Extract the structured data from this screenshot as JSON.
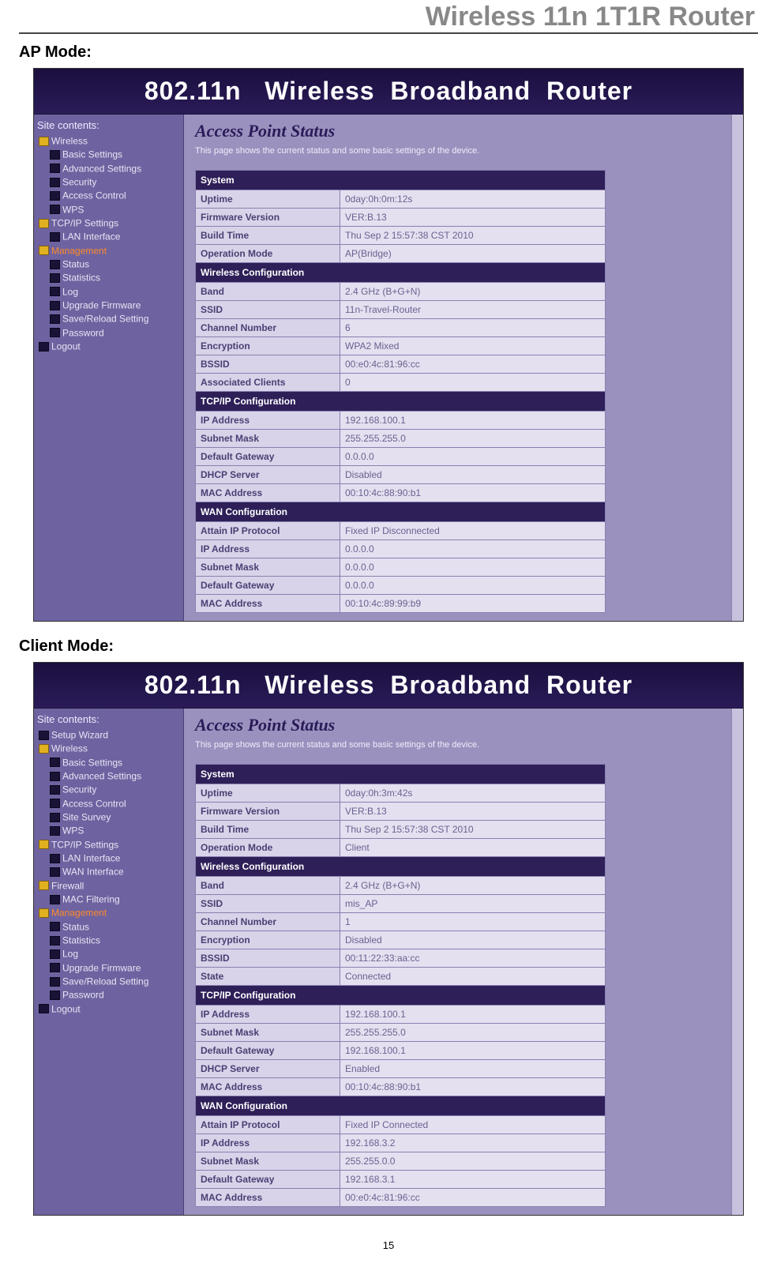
{
  "doc": {
    "header": "Wireless 11n 1T1R Router",
    "page_number": "15",
    "ap_mode_label": "AP Mode:",
    "client_mode_label": "Client Mode:"
  },
  "common": {
    "banner": "802.11n   Wireless  Broadband  Router",
    "sidebar_title": "Site contents:",
    "page_title": "Access Point Status",
    "page_desc": "This page shows the current status and some basic settings of the device."
  },
  "ap": {
    "sidebar": [
      {
        "type": "folder",
        "label": "Wireless",
        "children": [
          {
            "type": "page",
            "label": "Basic Settings"
          },
          {
            "type": "page",
            "label": "Advanced Settings"
          },
          {
            "type": "page",
            "label": "Security"
          },
          {
            "type": "page",
            "label": "Access Control"
          },
          {
            "type": "page",
            "label": "WPS"
          }
        ]
      },
      {
        "type": "folder",
        "label": "TCP/IP Settings",
        "children": [
          {
            "type": "page",
            "label": "LAN Interface"
          }
        ]
      },
      {
        "type": "folder",
        "label": "Management",
        "active": true,
        "children": [
          {
            "type": "page",
            "label": "Status"
          },
          {
            "type": "page",
            "label": "Statistics"
          },
          {
            "type": "page",
            "label": "Log"
          },
          {
            "type": "page",
            "label": "Upgrade Firmware"
          },
          {
            "type": "page",
            "label": "Save/Reload Setting"
          },
          {
            "type": "page",
            "label": "Password"
          }
        ]
      },
      {
        "type": "page",
        "label": "Logout"
      }
    ],
    "sections": [
      {
        "heading": "System",
        "rows": [
          {
            "label": "Uptime",
            "value": "0day:0h:0m:12s"
          },
          {
            "label": "Firmware Version",
            "value": "VER:B.13"
          },
          {
            "label": "Build Time",
            "value": "Thu Sep 2 15:57:38 CST 2010"
          },
          {
            "label": "Operation Mode",
            "value": "AP(Bridge)"
          }
        ]
      },
      {
        "heading": "Wireless Configuration",
        "rows": [
          {
            "label": "Band",
            "value": "2.4 GHz (B+G+N)"
          },
          {
            "label": "SSID",
            "value": "11n-Travel-Router"
          },
          {
            "label": "Channel Number",
            "value": "6"
          },
          {
            "label": "Encryption",
            "value": "WPA2 Mixed"
          },
          {
            "label": "BSSID",
            "value": "00:e0:4c:81:96:cc"
          },
          {
            "label": "Associated Clients",
            "value": "0"
          }
        ]
      },
      {
        "heading": "TCP/IP Configuration",
        "rows": [
          {
            "label": "IP Address",
            "value": "192.168.100.1"
          },
          {
            "label": "Subnet Mask",
            "value": "255.255.255.0"
          },
          {
            "label": "Default Gateway",
            "value": "0.0.0.0"
          },
          {
            "label": "DHCP Server",
            "value": "Disabled"
          },
          {
            "label": "MAC Address",
            "value": "00:10:4c:88:90:b1"
          }
        ]
      },
      {
        "heading": "WAN Configuration",
        "rows": [
          {
            "label": "Attain IP Protocol",
            "value": "Fixed IP Disconnected"
          },
          {
            "label": "IP Address",
            "value": "0.0.0.0"
          },
          {
            "label": "Subnet Mask",
            "value": "0.0.0.0"
          },
          {
            "label": "Default Gateway",
            "value": "0.0.0.0"
          },
          {
            "label": "MAC Address",
            "value": "00:10:4c:89:99:b9"
          }
        ]
      }
    ]
  },
  "client": {
    "sidebar": [
      {
        "type": "page",
        "label": "Setup Wizard"
      },
      {
        "type": "folder",
        "label": "Wireless",
        "children": [
          {
            "type": "page",
            "label": "Basic Settings"
          },
          {
            "type": "page",
            "label": "Advanced Settings"
          },
          {
            "type": "page",
            "label": "Security"
          },
          {
            "type": "page",
            "label": "Access Control"
          },
          {
            "type": "page",
            "label": "Site Survey"
          },
          {
            "type": "page",
            "label": "WPS"
          }
        ]
      },
      {
        "type": "folder",
        "label": "TCP/IP Settings",
        "children": [
          {
            "type": "page",
            "label": "LAN Interface"
          },
          {
            "type": "page",
            "label": "WAN Interface"
          }
        ]
      },
      {
        "type": "folder",
        "label": "Firewall",
        "children": [
          {
            "type": "page",
            "label": "MAC Filtering"
          }
        ]
      },
      {
        "type": "folder",
        "label": "Management",
        "active": true,
        "children": [
          {
            "type": "page",
            "label": "Status"
          },
          {
            "type": "page",
            "label": "Statistics"
          },
          {
            "type": "page",
            "label": "Log"
          },
          {
            "type": "page",
            "label": "Upgrade Firmware"
          },
          {
            "type": "page",
            "label": "Save/Reload Setting"
          },
          {
            "type": "page",
            "label": "Password"
          }
        ]
      },
      {
        "type": "page",
        "label": "Logout"
      }
    ],
    "sections": [
      {
        "heading": "System",
        "rows": [
          {
            "label": "Uptime",
            "value": "0day:0h:3m:42s"
          },
          {
            "label": "Firmware Version",
            "value": "VER:B.13"
          },
          {
            "label": "Build Time",
            "value": "Thu Sep 2 15:57:38 CST 2010"
          },
          {
            "label": "Operation Mode",
            "value": "Client"
          }
        ]
      },
      {
        "heading": "Wireless Configuration",
        "rows": [
          {
            "label": "Band",
            "value": "2.4 GHz (B+G+N)"
          },
          {
            "label": "SSID",
            "value": "mis_AP"
          },
          {
            "label": "Channel Number",
            "value": "1"
          },
          {
            "label": "Encryption",
            "value": "Disabled"
          },
          {
            "label": "BSSID",
            "value": "00:11:22:33:aa:cc"
          },
          {
            "label": "State",
            "value": "Connected"
          }
        ]
      },
      {
        "heading": "TCP/IP Configuration",
        "rows": [
          {
            "label": "IP Address",
            "value": "192.168.100.1"
          },
          {
            "label": "Subnet Mask",
            "value": "255.255.255.0"
          },
          {
            "label": "Default Gateway",
            "value": "192.168.100.1"
          },
          {
            "label": "DHCP Server",
            "value": "Enabled"
          },
          {
            "label": "MAC Address",
            "value": "00:10:4c:88:90:b1"
          }
        ]
      },
      {
        "heading": "WAN Configuration",
        "rows": [
          {
            "label": "Attain IP Protocol",
            "value": "Fixed IP Connected"
          },
          {
            "label": "IP Address",
            "value": "192.168.3.2"
          },
          {
            "label": "Subnet Mask",
            "value": "255.255.0.0"
          },
          {
            "label": "Default Gateway",
            "value": "192.168.3.1"
          },
          {
            "label": "MAC Address",
            "value": "00:e0:4c:81:96:cc"
          }
        ]
      }
    ]
  }
}
